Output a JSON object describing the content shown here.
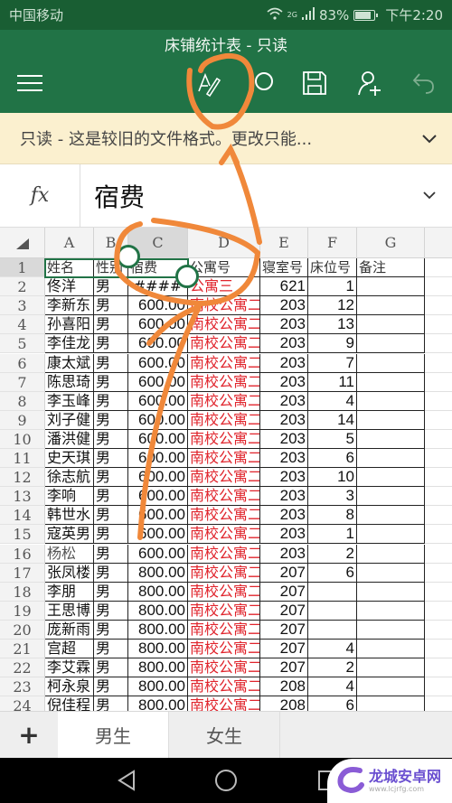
{
  "status_bar": {
    "carrier": "中国移动",
    "network": "2G",
    "battery": "83%",
    "battery_level": 0.83,
    "time": "下午2:20"
  },
  "app": {
    "title": "床铺统计表 - 只读",
    "toolbar_icons": [
      "menu-icon",
      "edit-icon",
      "search-icon",
      "save-icon",
      "share-person-icon",
      "undo-icon"
    ]
  },
  "banner": {
    "message": "只读 - 这是较旧的文件格式。更改只能...",
    "expand_icon": "chevron-down-icon"
  },
  "formula_bar": {
    "fx_label": "fx",
    "value": "宿费"
  },
  "grid": {
    "columns": [
      "A",
      "B",
      "C",
      "D",
      "E",
      "F",
      "G"
    ],
    "selected_column": "C",
    "selected_cell": "C1",
    "header_row": {
      "row": "1",
      "cells": [
        "姓名",
        "性别",
        "宿费",
        "公寓号",
        "寝室号",
        "床位号",
        "备注"
      ]
    },
    "rows": [
      {
        "row": "2",
        "name": "佟洋",
        "gender": "男",
        "fee": "####",
        "apt": "公寓三",
        "room": "621",
        "bed": "1",
        "note": ""
      },
      {
        "row": "3",
        "name": "李新东",
        "gender": "男",
        "fee": "600.00",
        "apt": "南校公寓二",
        "room": "203",
        "bed": "12",
        "note": ""
      },
      {
        "row": "4",
        "name": "孙喜阳",
        "gender": "男",
        "fee": "600.00",
        "apt": "南校公寓二",
        "room": "203",
        "bed": "13",
        "note": ""
      },
      {
        "row": "5",
        "name": "李佳龙",
        "gender": "男",
        "fee": "600.00",
        "apt": "南校公寓二",
        "room": "203",
        "bed": "9",
        "note": ""
      },
      {
        "row": "6",
        "name": "康太斌",
        "gender": "男",
        "fee": "600.00",
        "apt": "南校公寓二",
        "room": "203",
        "bed": "7",
        "note": ""
      },
      {
        "row": "7",
        "name": "陈思琦",
        "gender": "男",
        "fee": "600.00",
        "apt": "南校公寓二",
        "room": "203",
        "bed": "11",
        "note": ""
      },
      {
        "row": "8",
        "name": "李玉峰",
        "gender": "男",
        "fee": "600.00",
        "apt": "南校公寓二",
        "room": "203",
        "bed": "4",
        "note": ""
      },
      {
        "row": "9",
        "name": "刘子健",
        "gender": "男",
        "fee": "600.00",
        "apt": "南校公寓二",
        "room": "203",
        "bed": "14",
        "note": ""
      },
      {
        "row": "10",
        "name": "潘洪健",
        "gender": "男",
        "fee": "600.00",
        "apt": "南校公寓二",
        "room": "203",
        "bed": "5",
        "note": ""
      },
      {
        "row": "11",
        "name": "史天琪",
        "gender": "男",
        "fee": "600.00",
        "apt": "南校公寓二",
        "room": "203",
        "bed": "6",
        "note": ""
      },
      {
        "row": "12",
        "name": "徐志航",
        "gender": "男",
        "fee": "600.00",
        "apt": "南校公寓二",
        "room": "203",
        "bed": "10",
        "note": ""
      },
      {
        "row": "13",
        "name": "李响",
        "gender": "男",
        "fee": "600.00",
        "apt": "南校公寓二",
        "room": "203",
        "bed": "3",
        "note": ""
      },
      {
        "row": "14",
        "name": "韩世水",
        "gender": "男",
        "fee": "600.00",
        "apt": "南校公寓二",
        "room": "203",
        "bed": "8",
        "note": ""
      },
      {
        "row": "15",
        "name": "寇英男",
        "gender": "男",
        "fee": "600.00",
        "apt": "南校公寓二",
        "room": "203",
        "bed": "1",
        "note": ""
      },
      {
        "row": "16",
        "name": "杨松",
        "gender": "男",
        "fee": "600.00",
        "apt": "南校公寓二",
        "room": "203",
        "bed": "2",
        "note": ""
      },
      {
        "row": "17",
        "name": "张凤楼",
        "gender": "男",
        "fee": "800.00",
        "apt": "南校公寓二",
        "room": "207",
        "bed": "6",
        "note": ""
      },
      {
        "row": "18",
        "name": "李朋",
        "gender": "男",
        "fee": "800.00",
        "apt": "南校公寓二",
        "room": "207",
        "bed": "",
        "note": ""
      },
      {
        "row": "19",
        "name": "王思博",
        "gender": "男",
        "fee": "800.00",
        "apt": "南校公寓二",
        "room": "207",
        "bed": "",
        "note": ""
      },
      {
        "row": "20",
        "name": "庞新雨",
        "gender": "男",
        "fee": "800.00",
        "apt": "南校公寓二",
        "room": "207",
        "bed": "",
        "note": ""
      },
      {
        "row": "21",
        "name": "宫超",
        "gender": "男",
        "fee": "800.00",
        "apt": "南校公寓二",
        "room": "207",
        "bed": "4",
        "note": ""
      },
      {
        "row": "22",
        "name": "李艾霖",
        "gender": "男",
        "fee": "800.00",
        "apt": "南校公寓二",
        "room": "207",
        "bed": "2",
        "note": ""
      },
      {
        "row": "23",
        "name": "柯永泉",
        "gender": "男",
        "fee": "800.00",
        "apt": "南校公寓二",
        "room": "208",
        "bed": "4",
        "note": ""
      },
      {
        "row": "24",
        "name": "倪佳程",
        "gender": "男",
        "fee": "800.00",
        "apt": "南校公寓二",
        "room": "208",
        "bed": "6",
        "note": ""
      }
    ]
  },
  "sheet_tabs": {
    "add_label": "+",
    "tabs": [
      {
        "label": "男生",
        "active": true
      },
      {
        "label": "女生",
        "active": false
      }
    ]
  },
  "watermark": {
    "name": "龙城安卓网",
    "url": "www.lcjrfg.com"
  },
  "colors": {
    "excel_green": "#217346",
    "status_green": "#195e33",
    "banner_yellow": "#fbf0cf",
    "apt_red": "#e0242c",
    "annotation_orange": "#f0883a"
  }
}
